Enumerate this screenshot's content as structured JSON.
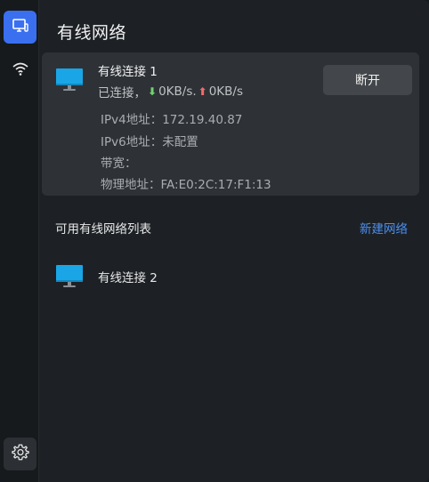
{
  "panel": {
    "title": "有线网络"
  },
  "rail": {
    "items": [
      {
        "name": "wired",
        "icon": "wired-network-icon",
        "active": true
      },
      {
        "name": "wireless",
        "icon": "wifi-icon",
        "active": false
      }
    ],
    "settings_icon": "gear-icon"
  },
  "current": {
    "name": "有线连接 1",
    "status_prefix": "已连接，",
    "download": "0KB/s.",
    "upload": "0KB/s",
    "disconnect_label": "断开",
    "details": [
      "IPv4地址：172.19.40.87",
      "IPv6地址：未配置",
      "带宽：",
      "物理地址：FA:E0:2C:17:F1:13"
    ]
  },
  "available": {
    "header": "可用有线网络列表",
    "new_network_label": "新建网络",
    "items": [
      {
        "name": "有线连接 2"
      }
    ]
  },
  "colors": {
    "accent": "#3a6ff0",
    "link": "#4d8ff0",
    "monitor": "#1aa6e6",
    "download_arrow": "#6fd36f",
    "upload_arrow": "#f26a6a"
  }
}
